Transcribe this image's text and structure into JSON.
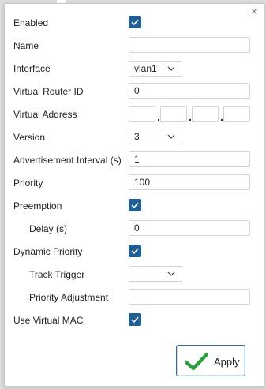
{
  "close_glyph": "×",
  "accent_color": "#1f5f96",
  "icons": [
    "close-icon",
    "checkmark-icon",
    "chevron-down-icon",
    "apply-check-icon"
  ],
  "fields": {
    "enabled": {
      "label": "Enabled",
      "checked": true
    },
    "name": {
      "label": "Name",
      "value": ""
    },
    "interface": {
      "label": "Interface",
      "value": "vlan1"
    },
    "virtual_router_id": {
      "label": "Virtual Router ID",
      "value": "0"
    },
    "virtual_address": {
      "label": "Virtual Address",
      "octets": [
        "",
        "",
        "",
        ""
      ],
      "separator": "."
    },
    "version": {
      "label": "Version",
      "value": "3"
    },
    "advertisement_interval": {
      "label": "Advertisement Interval (s)",
      "value": "1"
    },
    "priority": {
      "label": "Priority",
      "value": "100"
    },
    "preemption": {
      "label": "Preemption",
      "checked": true
    },
    "delay": {
      "label": "Delay (s)",
      "value": "0"
    },
    "dynamic_priority": {
      "label": "Dynamic Priority",
      "checked": true
    },
    "track_trigger": {
      "label": "Track Trigger",
      "value": ""
    },
    "priority_adjustment": {
      "label": "Priority Adjustment",
      "value": ""
    },
    "use_virtual_mac": {
      "label": "Use Virtual MAC",
      "checked": true
    }
  },
  "apply_label": "Apply"
}
